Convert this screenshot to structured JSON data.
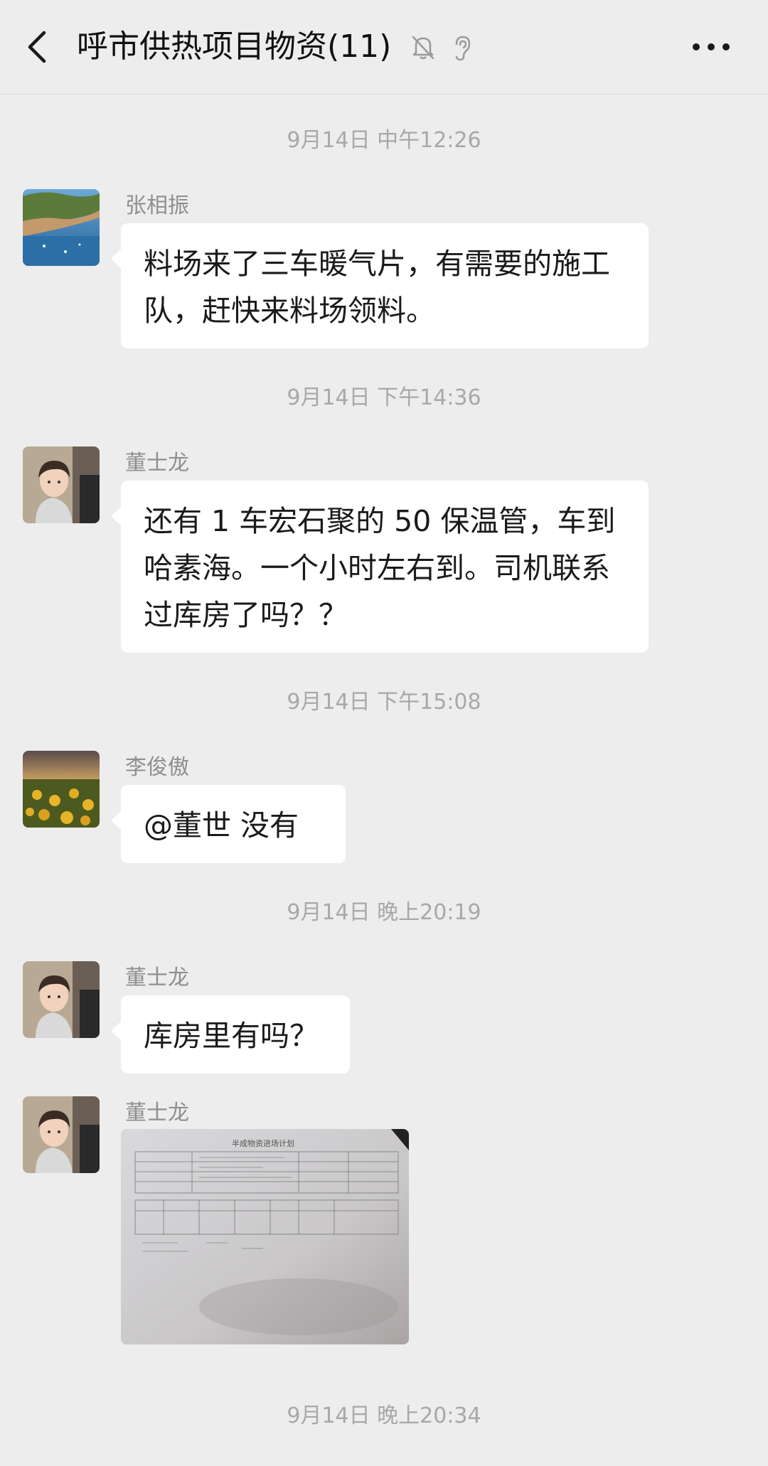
{
  "header": {
    "title": "呼市供热项目物资(11)",
    "back_icon": "chevron-left-icon",
    "mute_icon": "bell-muted-icon",
    "earpiece_icon": "ear-icon",
    "more_icon": "more-horizontal-icon"
  },
  "messages": [
    {
      "time": "9月14日 中午12:26",
      "sender": "张相振",
      "text": "料场来了三车暖气片，有需要的施工队，赶快来料场领料。"
    },
    {
      "time": "9月14日 下午14:36",
      "sender": "董士龙",
      "text": "还有 1 车宏石聚的 50 保温管，车到哈素海。一个小时左右到。司机联系过库房了吗？？"
    },
    {
      "time": "9月14日 下午15:08",
      "sender": "李俊傲",
      "text": "@董世  没有"
    },
    {
      "time": "9月14日 晚上20:19",
      "sender": "董士龙",
      "text": "库房里有吗？"
    },
    {
      "sender": "董士龙",
      "type": "image",
      "image_caption": "半成物资进场计划"
    },
    {
      "time": "9月14日 晚上20:34"
    }
  ],
  "colors": {
    "background": "#ededed",
    "bubble": "#ffffff",
    "timestamp": "#a8a8a8",
    "sender": "#8f8f8f"
  }
}
